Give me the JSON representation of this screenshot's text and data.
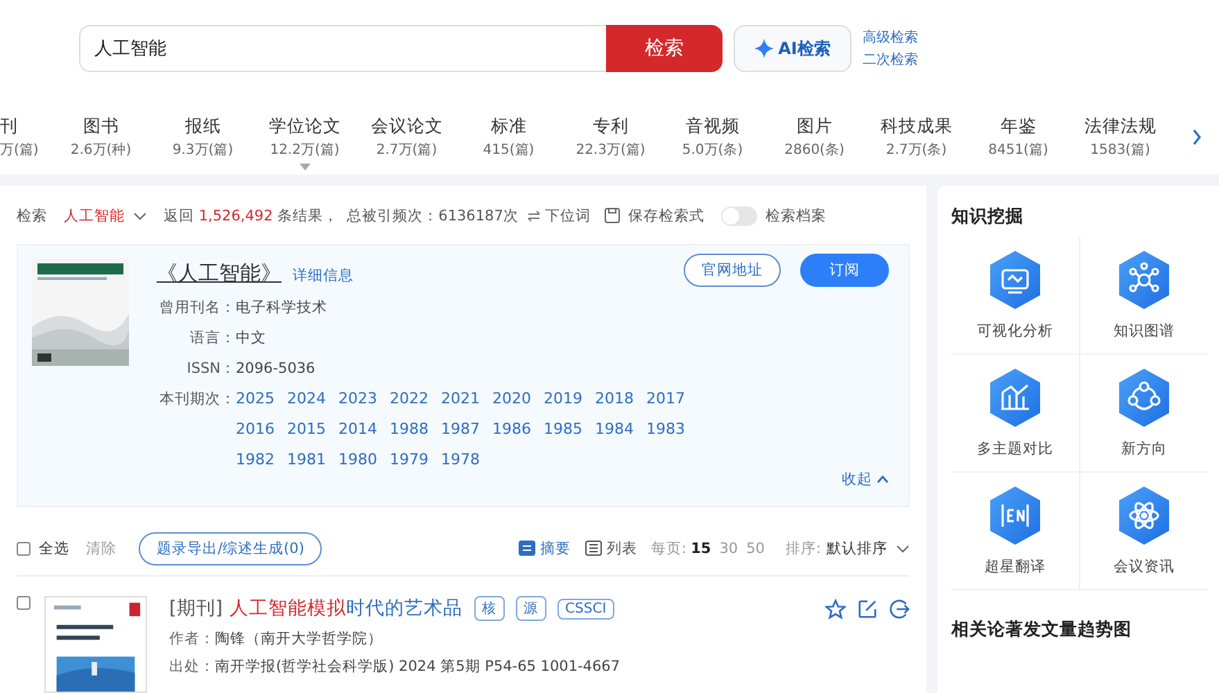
{
  "search": {
    "value": "人工智能",
    "button": "检索",
    "ai_button": "AI检索",
    "links": [
      "高级检索",
      "二次检索"
    ]
  },
  "categories": [
    {
      "name": "刊",
      "count": "万(篇)",
      "selected": false
    },
    {
      "name": "图书",
      "count": "2.6万(种)",
      "selected": false
    },
    {
      "name": "报纸",
      "count": "9.3万(篇)",
      "selected": false
    },
    {
      "name": "学位论文",
      "count": "12.2万(篇)",
      "selected": true
    },
    {
      "name": "会议论文",
      "count": "2.7万(篇)",
      "selected": false
    },
    {
      "name": "标准",
      "count": "415(篇)",
      "selected": false
    },
    {
      "name": "专利",
      "count": "22.3万(篇)",
      "selected": false
    },
    {
      "name": "音视频",
      "count": "5.0万(条)",
      "selected": false
    },
    {
      "name": "图片",
      "count": "2860(条)",
      "selected": false
    },
    {
      "name": "科技成果",
      "count": "2.7万(条)",
      "selected": false
    },
    {
      "name": "年鉴",
      "count": "8451(篇)",
      "selected": false
    },
    {
      "name": "法律法规",
      "count": "1583(篇)",
      "selected": false
    }
  ],
  "summary": {
    "label": "检索",
    "term": "人工智能",
    "result_prefix": "返回",
    "result_count": "1,526,492",
    "result_suffix": "条结果，",
    "citations": "总被引频次：6136187次",
    "subterm": "下位词",
    "save": "保存检索式",
    "archive": {
      "label": "检索档案",
      "on": false
    }
  },
  "journal": {
    "title": "《人工智能》",
    "details_link": "详细信息",
    "buttons": [
      "官网地址",
      "订阅"
    ],
    "fields": [
      {
        "label": "曾用刊名：",
        "value": "电子科学技术"
      },
      {
        "label": "语言：",
        "value": "中文"
      },
      {
        "label": "ISSN：",
        "value": "2096-5036"
      }
    ],
    "issues_label": "本刊期次：",
    "issues": [
      "2025",
      "2024",
      "2023",
      "2022",
      "2021",
      "2020",
      "2019",
      "2018",
      "2017",
      "2016",
      "2015",
      "2014",
      "1988",
      "1987",
      "1986",
      "1985",
      "1984",
      "1983",
      "1982",
      "1981",
      "1980",
      "1979",
      "1978"
    ],
    "collapse": "收起"
  },
  "toolbar": {
    "select_all": {
      "label": "全选",
      "checked": false
    },
    "clear": "清除",
    "export": "题录导出/综述生成(0)",
    "views": [
      {
        "label": "摘要",
        "selected": true
      },
      {
        "label": "列表",
        "selected": false
      }
    ],
    "page_size_label": "每页:",
    "page_sizes": [
      {
        "label": "15",
        "selected": true
      },
      {
        "label": "30",
        "selected": false
      },
      {
        "label": "50",
        "selected": false
      }
    ],
    "sort_label": "排序:",
    "sort": "默认排序"
  },
  "results": [
    {
      "checked": false,
      "type": "[期刊]",
      "title_parts": [
        {
          "text": "人工智能模拟",
          "highlighted": true
        },
        {
          "text": "时代的艺术品",
          "highlighted": false
        }
      ],
      "tags": [
        "核",
        "源",
        "CSSCI"
      ],
      "author_label": "作者：",
      "author": "陶锋（南开大学哲学院）",
      "source_label": "出处：",
      "source": "南开学报(哲学社会科学版) 2024 第5期 P54-65  1001-4667"
    }
  ],
  "sidebar": {
    "title": "知识挖掘",
    "tools": [
      "可视化分析",
      "知识图谱",
      "多主题对比",
      "新方向",
      "超星翻译",
      "会议资讯"
    ],
    "trend_title": "相关论著发文量趋势图"
  }
}
